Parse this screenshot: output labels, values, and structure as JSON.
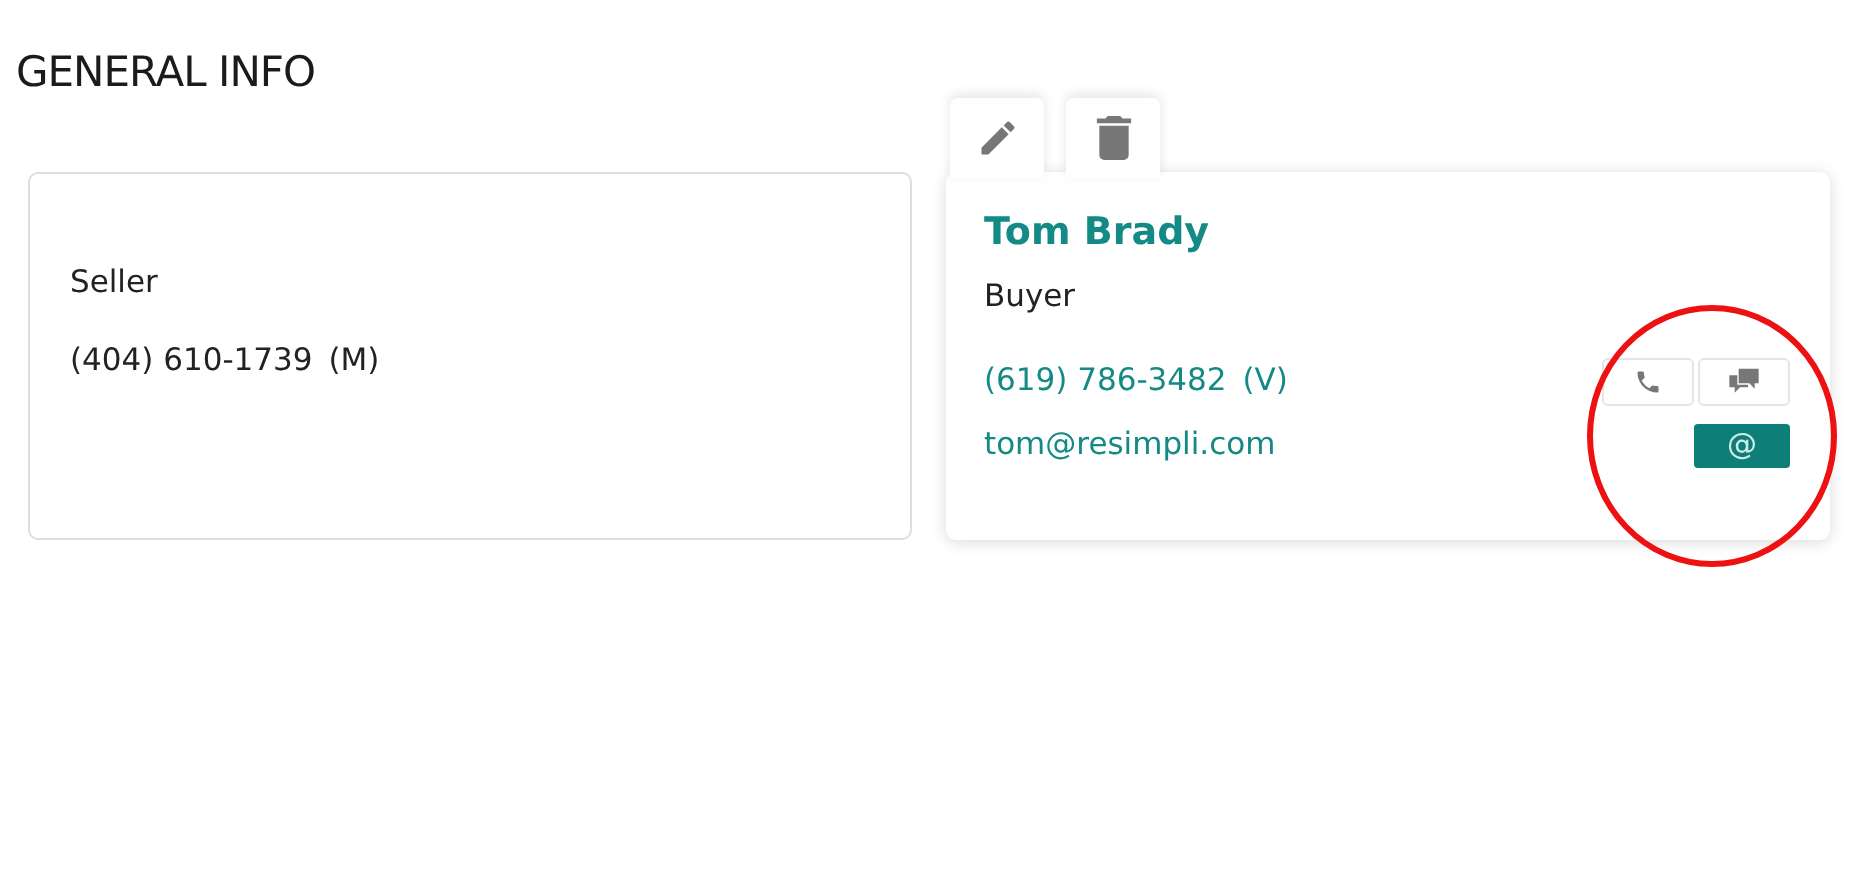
{
  "heading": "GENERAL INFO",
  "contacts": [
    {
      "kind": "plain",
      "role": "Seller",
      "phone": "(404) 610-1739",
      "phone_type": "(M)"
    },
    {
      "kind": "detailed",
      "name": "Tom Brady",
      "role": "Buyer",
      "phone": "(619) 786-3482",
      "phone_type": "(V)",
      "email": "tom@resimpli.com",
      "email_button": "@"
    }
  ],
  "annotations": [
    {
      "kind": "circle"
    }
  ]
}
